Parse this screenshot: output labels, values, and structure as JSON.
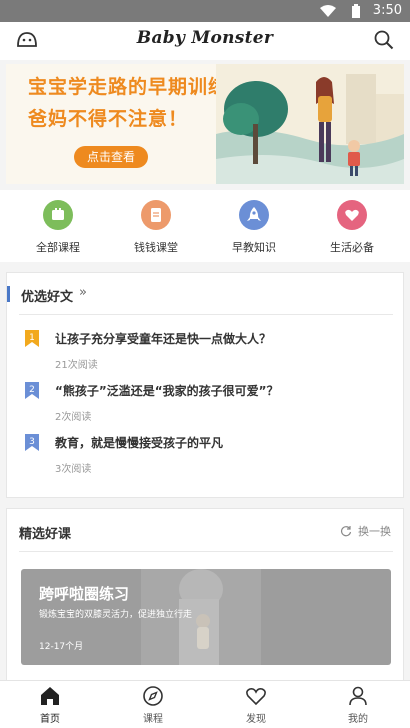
{
  "status_bar": {
    "time": "3:50",
    "icons": [
      "wifi-icon",
      "battery-icon"
    ]
  },
  "header": {
    "title": "Baby Monster",
    "left_icon": "face-icon",
    "right_icon": "search-icon"
  },
  "banner": {
    "line1": "宝宝学走路的早期训练，",
    "line2": "爸妈不得不注意！",
    "cta": "点击查看",
    "accent": "#ee8a1f"
  },
  "categories": [
    {
      "label": "全部课程",
      "icon": "courses-icon",
      "color": "#7dbd5b"
    },
    {
      "label": "钱钱课堂",
      "icon": "money-class-icon",
      "color": "#ed9a6b"
    },
    {
      "label": "早教知识",
      "icon": "rocket-icon",
      "color": "#6b8fd6"
    },
    {
      "label": "生活必备",
      "icon": "heart-icon",
      "color": "#e5647f"
    }
  ],
  "articles": {
    "title": "优选好文",
    "more": "»",
    "items": [
      {
        "rank": "1",
        "title": "让孩子充分享受童年还是快一点做大人？",
        "reads": "21次阅读"
      },
      {
        "rank": "2",
        "title": "“熊孩子”泛滥还是“我家的孩子很可爱”？",
        "reads": "2次阅读"
      },
      {
        "rank": "3",
        "title": "教育，就是慢慢接受孩子的平凡",
        "reads": "3次阅读"
      }
    ]
  },
  "courses": {
    "title": "精选好课",
    "swap_label": "换一换",
    "featured": {
      "name": "跨呼啦圈练习",
      "desc": "锻炼宝宝的双膝灵活力，促进独立行走",
      "age": "12-17个月"
    }
  },
  "tabs": [
    {
      "label": "首页",
      "icon": "home-icon",
      "active": true
    },
    {
      "label": "课程",
      "icon": "compass-icon",
      "active": false
    },
    {
      "label": "发现",
      "icon": "heart-outline-icon",
      "active": false
    },
    {
      "label": "我的",
      "icon": "person-icon",
      "active": false
    }
  ]
}
